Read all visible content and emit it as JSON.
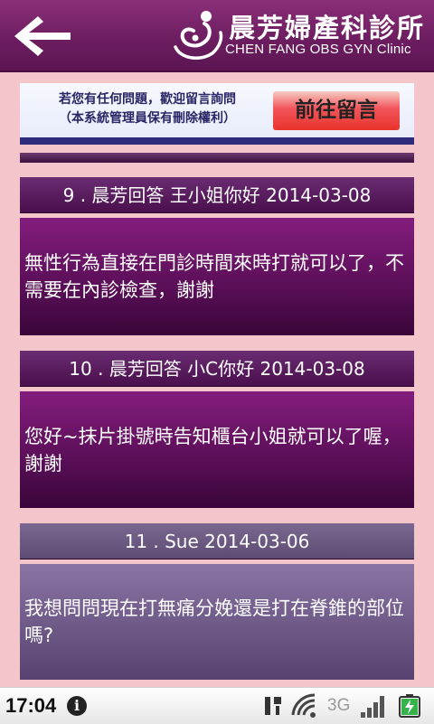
{
  "header": {
    "back_icon": "back-arrow-icon",
    "clinic_name": "晨芳婦產科診所",
    "clinic_name_en": "CHEN FANG OBS GYN Clinic",
    "logo_icon": "mother-baby-logo",
    "bg_color": "#6b1c5f"
  },
  "banner": {
    "line1": "若您有任何問題，歡迎留言詢問",
    "line2": "（本系統管理員保有刪除權利）",
    "button_label": "前往留言",
    "button_color": "#e8332a"
  },
  "qa_items": [
    {
      "title": "9 . 晨芳回答 王小姐你好  2014-03-08",
      "body": "無性行為直接在門診時間來時打就可以了，不需要在內診檢查，謝謝",
      "style": "purple"
    },
    {
      "title": "10 . 晨芳回答 小C你好  2014-03-08",
      "body": "您好~抹片掛號時告知櫃台小姐就可以了喔，謝謝",
      "style": "purple"
    },
    {
      "title": "11 . Sue  2014-03-06",
      "body": "我想問問現在打無痛分娩還是打在脊錐的部位嗎?",
      "style": "gray"
    }
  ],
  "status_bar": {
    "time": "17:04",
    "info_icon": "info-icon",
    "network": "3G",
    "icons": [
      "usb-debug-icon",
      "wifi-icon",
      "signal-icon",
      "battery-charging-icon"
    ]
  },
  "colors": {
    "page_bg": "#f4c6cb",
    "purple_block": "#5d0f5a",
    "gray_block": "#6b5684"
  }
}
